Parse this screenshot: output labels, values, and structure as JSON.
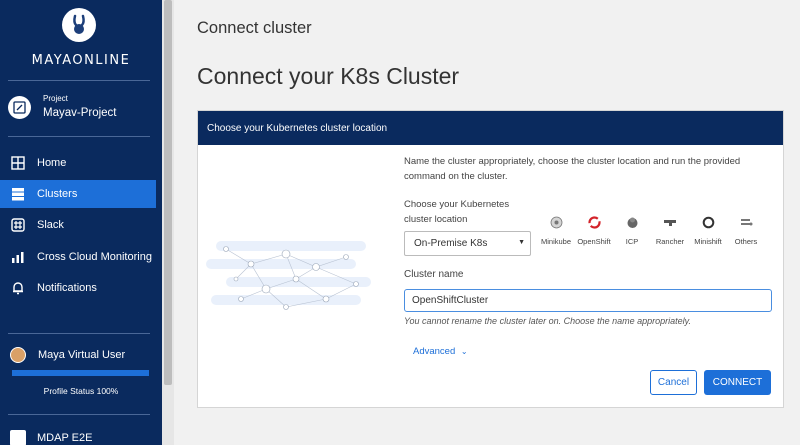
{
  "sidebar": {
    "brand": "MAYAONLINE",
    "project_label": "Project",
    "project_name": "Mayav-Project",
    "nav": [
      {
        "label": "Home",
        "icon": "home-icon"
      },
      {
        "label": "Clusters",
        "icon": "clusters-icon",
        "active": true
      },
      {
        "label": "Slack",
        "icon": "slack-icon"
      },
      {
        "label": "Cross Cloud Monitoring",
        "icon": "chart-icon"
      },
      {
        "label": "Notifications",
        "icon": "bell-icon"
      }
    ],
    "user_name": "Maya Virtual User",
    "profile_status": "Profile Status 100%",
    "profile_progress": 1.0,
    "org_name": "MDAP E2E"
  },
  "main": {
    "breadcrumb": "Connect cluster",
    "title": "Connect your K8s Cluster",
    "card": {
      "header": "Choose your Kubernetes cluster location",
      "description": "Name the cluster appropriately, choose the cluster location and run the provided command on the cluster.",
      "location_label": "Choose your Kubernetes cluster location",
      "location_value": "On-Premise K8s",
      "platforms": [
        "Minikube",
        "OpenShift",
        "ICP",
        "Rancher",
        "Minishift",
        "Others"
      ],
      "cluster_name_label": "Cluster name",
      "cluster_name_value": "OpenShiftCluster",
      "cluster_name_hint": "You cannot rename the cluster later on. Choose the name appropriately.",
      "advanced_label": "Advanced",
      "cancel_label": "Cancel",
      "connect_label": "CONNECT"
    }
  },
  "colors": {
    "sidebar_bg": "#0a2a5e",
    "accent": "#1d6fd8"
  }
}
